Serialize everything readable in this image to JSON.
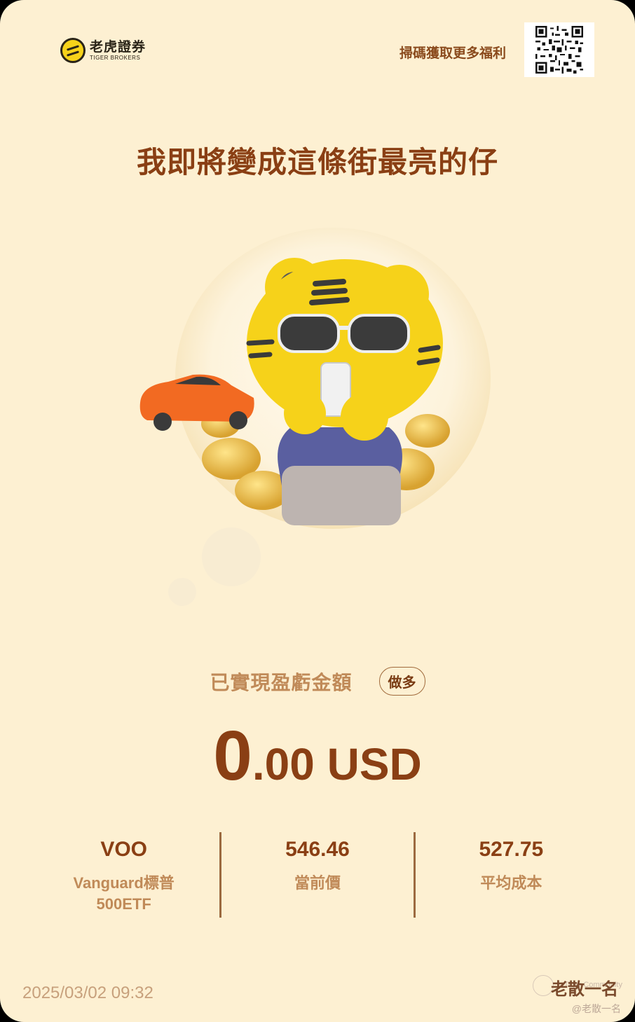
{
  "header": {
    "logo_cn": "老虎證券",
    "logo_en": "TIGER BROKERS",
    "scan_text": "掃碼獲取更多福利"
  },
  "headline": "我即將變成這條街最亮的仔",
  "pnl": {
    "label": "已實現盈虧金額",
    "direction_badge": "做多",
    "amount_integer": "0",
    "amount_rest": ".00 USD"
  },
  "stats": [
    {
      "value": "VOO",
      "sub": "Vanguard標普500ETF"
    },
    {
      "value": "546.46",
      "sub": "當前價"
    },
    {
      "value": "527.75",
      "sub": "平均成本"
    }
  ],
  "footer": {
    "date": "2025/03/02 09:32",
    "watermark_name": "老散一名",
    "watermark_handle": "@老散一名",
    "watermark_community": "Tiger Community"
  },
  "colors": {
    "background": "#fdf0d2",
    "primary_text": "#8a3f14",
    "secondary_text": "#c08a58",
    "tiger_yellow": "#f6d21a",
    "car_orange": "#f26a22"
  },
  "icons": [
    "tiger-brokers-logo-icon",
    "qr-code-icon",
    "tiger-mascot-illustration",
    "sports-car-icon",
    "gold-coins-icon"
  ]
}
